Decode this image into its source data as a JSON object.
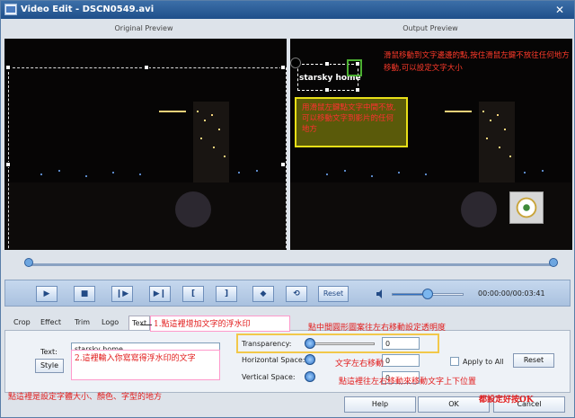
{
  "window": {
    "title": "Video Edit - DSCN0549.avi"
  },
  "preview": {
    "original_label": "Original Preview",
    "output_label": "Output Preview",
    "watermark_text": "starsky home",
    "annotation_top_right": "滑鼠移動到文字邊邊的點,按住滑鼠左鍵不放往任何地方移動,可以設定文字大小",
    "annotation_green_box": "用滑鼠左鍵點文字中間不放,可以移動文字到影片的任何地方"
  },
  "playback": {
    "reset_label": "Reset",
    "time": "00:00:00/00:03:41",
    "volume_level": 0.45
  },
  "tabs": [
    {
      "label": "Crop"
    },
    {
      "label": "Effect"
    },
    {
      "label": "Trim"
    },
    {
      "label": "Logo"
    },
    {
      "label": "Text"
    }
  ],
  "text_panel": {
    "text_label": "Text:",
    "text_value": "starsky home",
    "style_button": "Style",
    "transparency_label": "Transparency:",
    "transparency_value": "0",
    "horizontal_label": "Horizontal Space:",
    "horizontal_value": "0",
    "vertical_label": "Vertical Space:",
    "vertical_value": "0",
    "apply_all_label": "Apply to All",
    "reset_button": "Reset"
  },
  "annotations": {
    "tab_text": "1.點這裡增加文字的浮水印",
    "input_text": "2.這裡輸入你寫寫得浮水印的文字",
    "style_text": "點這裡是設定字體大小、顏色、字型的地方",
    "transparency_text": "點中間圓形圖案往左右移動設定透明度",
    "horizontal_text": "文字左右移動",
    "vertical_text": "點這裡往左右移動來移動文字上下位置",
    "done_text": "都設定好按OK"
  },
  "footer": {
    "help_button": "Help",
    "ok_button": "OK",
    "cancel_button": "Cancel"
  },
  "colors": {
    "title_bar": "#1f4f8a",
    "annotation_red": "#e21b1b",
    "accent_blue": "#2f6fc2"
  }
}
